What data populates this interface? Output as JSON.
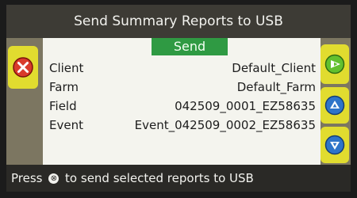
{
  "title": "Send Summary Reports to USB",
  "send_header": "Send",
  "rows": [
    {
      "label": "Client",
      "value": "Default_Client"
    },
    {
      "label": "Farm",
      "value": "Default_Farm"
    },
    {
      "label": "Field",
      "value": "042509_0001_EZ58635"
    },
    {
      "label": "Event",
      "value": "Event_042509_0002_EZ58635"
    }
  ],
  "status": {
    "prefix": "Press",
    "glyph": "⊗",
    "suffix": "to send selected reports to USB"
  },
  "icons": {
    "cancel": "cancel-x-icon",
    "next": "next-arrow-icon",
    "up": "up-arrow-icon",
    "down": "down-arrow-icon"
  },
  "colors": {
    "send_header": "#2f9a43",
    "cancel_button": "#d93a2b",
    "next_button": "#62c02e",
    "arrow_buttons": "#2e74c9",
    "side_panels": "#e1dc2f"
  }
}
